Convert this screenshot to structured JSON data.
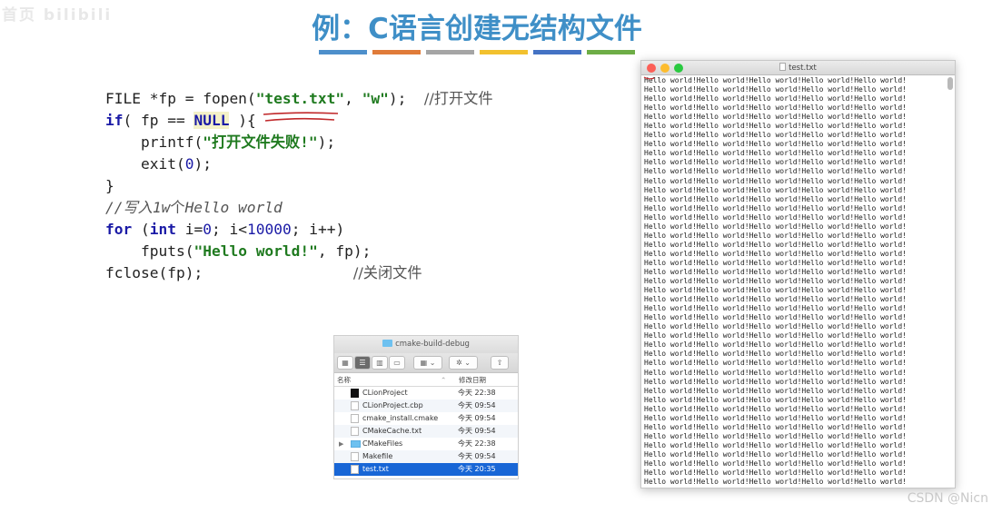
{
  "slide": {
    "title": "例：C语言创建无结构文件",
    "watermark_top": "首页 bilibili",
    "color_bars": [
      "#4d8fcb",
      "#e07b39",
      "#a5a5a5",
      "#f2c12e",
      "#4472c4",
      "#6dad46"
    ]
  },
  "code": {
    "l1": {
      "a": "FILE *fp = fopen(",
      "s1": "\"test.txt\"",
      "b": ", ",
      "s2": "\"w\"",
      "c": ");  ",
      "cmt": "//打开文件"
    },
    "l2": {
      "kw": "if",
      "a": "( fp == ",
      "null": "NULL",
      "b": " ){"
    },
    "l3": {
      "a": "    printf(",
      "s": "\"打开文件失败!\"",
      "b": ");"
    },
    "l4": {
      "a": "    exit(",
      "n": "0",
      "b": ");"
    },
    "l5": {
      "a": "}"
    },
    "l6": {
      "cmt1": "//写入",
      "cmt2": "1w",
      "cmt3": "个",
      "cmt4": "Hello world"
    },
    "l7": {
      "kw1": "for",
      "a": " (",
      "kw2": "int",
      "b": " i=",
      "n1": "0",
      "c": "; i<",
      "n2": "10000",
      "d": "; i++)"
    },
    "l8": {
      "a": "    fputs(",
      "s": "\"Hello world!\"",
      "b": ", fp);"
    },
    "l9": {
      "a": "fclose(fp);",
      "pad": "                 ",
      "cmt": "//关闭文件"
    }
  },
  "finder": {
    "window_title": "cmake-build-debug",
    "col_name": "名称",
    "col_date": "修改日期",
    "rows": [
      {
        "name": "CLionProject",
        "date": "今天 22:38",
        "icon": "exec-icon"
      },
      {
        "name": "CLionProject.cbp",
        "date": "今天 09:54",
        "icon": "doc-icon"
      },
      {
        "name": "cmake_install.cmake",
        "date": "今天 09:54",
        "icon": "doc-icon"
      },
      {
        "name": "CMakeCache.txt",
        "date": "今天 09:54",
        "icon": "doc-icon"
      },
      {
        "name": "CMakeFiles",
        "date": "今天 22:38",
        "icon": "folder-icon"
      },
      {
        "name": "Makefile",
        "date": "今天 09:54",
        "icon": "doc-icon"
      },
      {
        "name": "test.txt",
        "date": "今天 20:35",
        "icon": "doc-icon",
        "selected": true
      }
    ]
  },
  "textwindow": {
    "title": "test.txt",
    "line_text": "Hello world!Hello world!Hello world!Hello world!Hello world!",
    "visible_lines": 45
  },
  "footer": {
    "csdn": "CSDN @Nicn"
  }
}
